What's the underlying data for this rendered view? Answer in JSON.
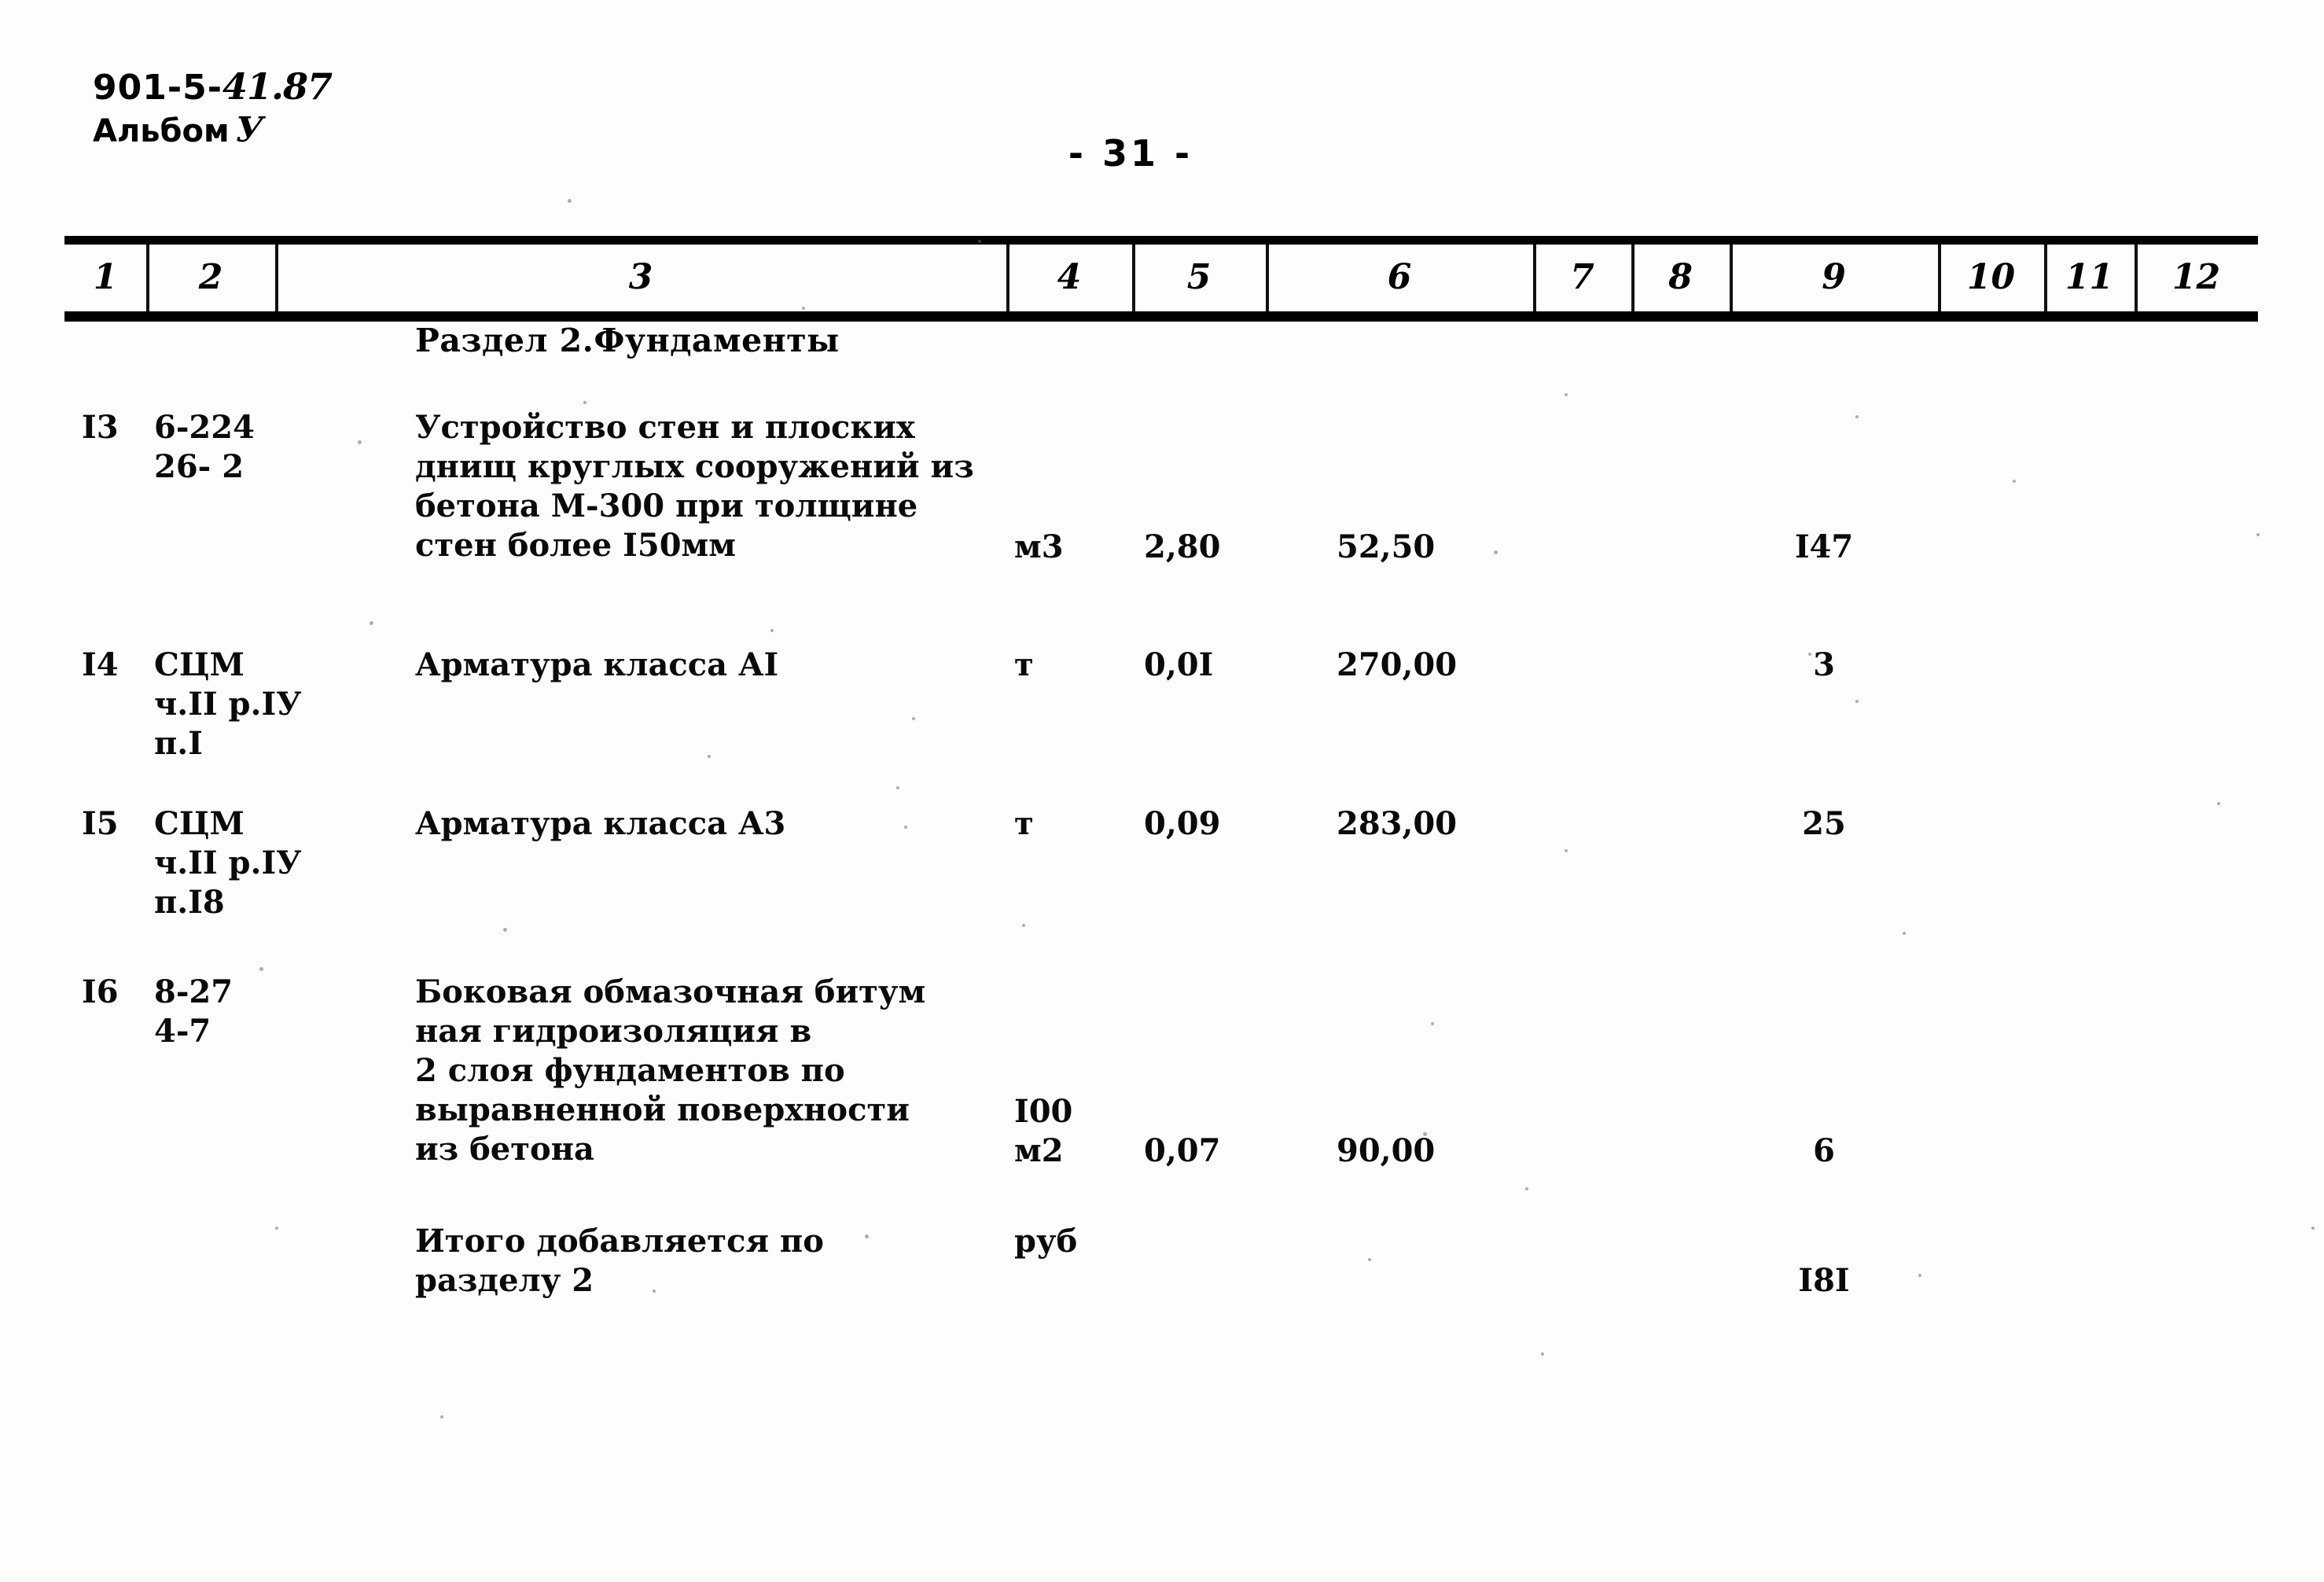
{
  "header": {
    "document_code": "901-5-",
    "document_code_hand": "41.87",
    "album_label": "Альбом",
    "album_value": "У",
    "page_number": "- 31 -"
  },
  "table": {
    "column_headers": [
      "1",
      "2",
      "3",
      "4",
      "5",
      "6",
      "7",
      "8",
      "9",
      "10",
      "11",
      "12"
    ],
    "section_title": "Раздел 2.Фундаменты",
    "rows": [
      {
        "num": "I3",
        "code": "6-224\n26- 2",
        "description": "Устройство стен и плоских\nднищ круглых сооружений из\nбетона М-300 при толщине\nстен более I50мм",
        "unit": "м3",
        "qty": "2,80",
        "price": "52,50",
        "c7": "",
        "c8": "",
        "total": "I47",
        "c10": "",
        "c11": "",
        "c12": ""
      },
      {
        "num": "I4",
        "code": "СЦМ\nч.II р.IУ\nп.I",
        "description": "Арматура класса АI",
        "unit": "т",
        "qty": "0,0I",
        "price": "270,00",
        "c7": "",
        "c8": "",
        "total": "3",
        "c10": "",
        "c11": "",
        "c12": ""
      },
      {
        "num": "I5",
        "code": "СЦМ\nч.II р.IУ\nп.I8",
        "description": "Арматура класса А3",
        "unit": "т",
        "qty": "0,09",
        "price": "283,00",
        "c7": "",
        "c8": "",
        "total": "25",
        "c10": "",
        "c11": "",
        "c12": ""
      },
      {
        "num": "I6",
        "code": "8-27\n4-7",
        "description": "Боковая обмазочная битум\nная гидроизоляция в\n2 слоя фундаментов по\nвыравненной поверхности\nиз бетона",
        "unit": "I00\nм2",
        "qty": "0,07",
        "price": "90,00",
        "c7": "",
        "c8": "",
        "total": "6",
        "c10": "",
        "c11": "",
        "c12": ""
      }
    ],
    "summary_row": {
      "num": "",
      "code": "",
      "description": "Итого добавляется по\nразделу 2",
      "unit": "руб",
      "qty": "",
      "price": "",
      "c7": "",
      "c8": "",
      "total": "I8I",
      "c10": "",
      "c11": "",
      "c12": ""
    }
  }
}
